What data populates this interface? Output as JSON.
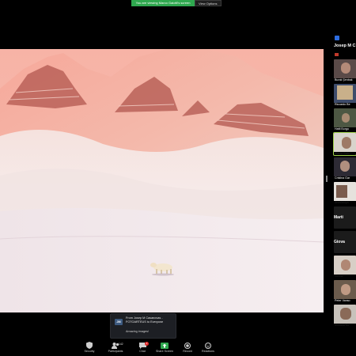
{
  "banner": {
    "share_text": "You are viewing Marco Gaiotti's screen",
    "view_options": "View Options"
  },
  "gallery": {
    "active_speaker": "Josep M C",
    "participants": [
      {
        "name": "Burak Şenbak"
      },
      {
        "name": "Riccardo Be"
      },
      {
        "name": "Hatti Burgu"
      },
      {
        "name": "Marco Gaio"
      },
      {
        "name": "Cristina Gar"
      },
      {
        "name": "Anastasiya"
      }
    ],
    "name_only_tiles": [
      {
        "label": "Marti"
      },
      {
        "label": "Giova"
      }
    ],
    "participants_lower": [
      {
        "name": "Sorina"
      },
      {
        "name": "Peter Vanso"
      },
      {
        "name": "Mustafa Ko"
      }
    ]
  },
  "chat_toast": {
    "avatar_initials": "JM",
    "from": "From Josep M Casanovas - FOTOARTEUS to Everyone",
    "message": "Amazing images!"
  },
  "toolbar": {
    "security": "Security",
    "participants": "Participants",
    "participants_count": "142",
    "chat": "Chat",
    "chat_badge": "2",
    "share_screen": "Share Screen",
    "record": "Record",
    "reactions": "Reactions"
  },
  "colors": {
    "share_banner": "#2fa84f",
    "share_button": "#2fa84f",
    "selected_tile": "#9fd04a",
    "chat_badge": "#e02828"
  }
}
